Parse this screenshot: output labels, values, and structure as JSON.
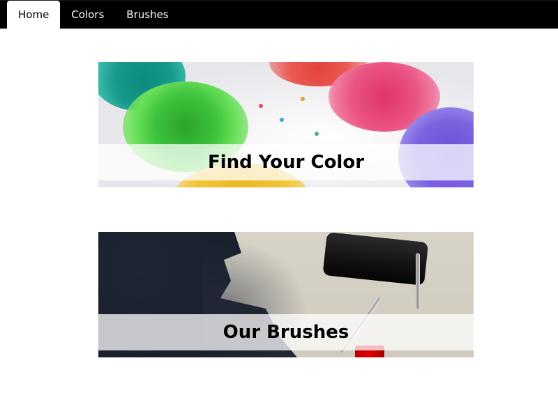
{
  "nav": {
    "items": [
      {
        "label": "Home",
        "active": true
      },
      {
        "label": "Colors",
        "active": false
      },
      {
        "label": "Brushes",
        "active": false
      }
    ]
  },
  "cards": [
    {
      "title": "Find Your Color",
      "image": "watercolor-palette-image"
    },
    {
      "title": "Our Brushes",
      "image": "paint-roller-image"
    }
  ],
  "colors": {
    "navbar": "#000000",
    "active_tab": "#ffffff",
    "caption_band": "rgba(255,255,255,0.75)"
  }
}
